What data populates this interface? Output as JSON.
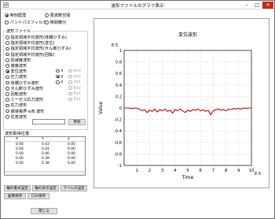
{
  "window": {
    "title": "波形ファイルのグラフ表示"
  },
  "mode_options": [
    {
      "label": "時刻歴歴",
      "selected": true
    },
    {
      "label": "周波数空間",
      "selected": false
    },
    {
      "label": "パンドパスフィルタ",
      "selected": false
    },
    {
      "label": "時間積分",
      "selected": false
    }
  ],
  "file_group": {
    "title": "波形ファイル",
    "items": [
      {
        "label": "指定領域平均波形(体積ひずみ)",
        "selected": false
      },
      {
        "label": "指定領域平均波形(変位)",
        "selected": false
      },
      {
        "label": "指定領域平均波形(せん断ひずみ)",
        "selected": false
      },
      {
        "label": "指定領域平均波形(回転)",
        "selected": false
      },
      {
        "label": "加速度波形",
        "selected": false
      },
      {
        "label": "速度波形",
        "selected": false
      },
      {
        "label": "変位波形",
        "selected": true
      },
      {
        "label": "圧力波形",
        "selected": false
      },
      {
        "label": "体積ひずみ波形",
        "selected": false
      },
      {
        "label": "せん断ひずみ波形",
        "selected": false
      },
      {
        "label": "回転波形",
        "selected": false
      },
      {
        "label": "ミーゼス応力波形",
        "selected": false
      },
      {
        "label": "応力波形",
        "selected": false
      },
      {
        "label": "誘導電界 e/B 波形",
        "selected": false
      },
      {
        "label": "任意波形",
        "selected": false
      }
    ],
    "component_options": [
      {
        "label": "x",
        "selected": false,
        "disabled": false
      },
      {
        "label": "y",
        "selected": true,
        "disabled": false
      },
      {
        "label": "z",
        "selected": false,
        "disabled": false
      }
    ],
    "stress_options": [
      {
        "label": "σxx",
        "disabled": true
      },
      {
        "label": "σyy",
        "disabled": true
      },
      {
        "label": "σzz",
        "disabled": true
      },
      {
        "label": "Exy",
        "disabled": true
      },
      {
        "label": "Eyz",
        "disabled": true
      },
      {
        "label": "Ezx",
        "disabled": true
      }
    ],
    "browse_label": "参照"
  },
  "output_positions": {
    "title": "波形取得位置",
    "headers": [
      "X",
      "Y",
      "Z"
    ],
    "rows": [
      [
        "0.00",
        "0.43",
        "0.00"
      ],
      [
        "0.00",
        "0.41",
        "0.00"
      ],
      [
        "0.00",
        "0.40",
        "0.00"
      ],
      [
        "0.00",
        "0.39",
        "0.00"
      ],
      [
        "0.00",
        "0.38",
        "0.00"
      ]
    ]
  },
  "buttons": {
    "axis_settings": "軸の書式設定",
    "axis_range": "軸の表示設定",
    "label_settings": "ラベルの設定",
    "save_image": "画像保存",
    "save_csv": "CSV保存",
    "close": "閉じる"
  },
  "chart_data": {
    "type": "line",
    "title": "変位波形",
    "xlabel": "Time",
    "ylabel": "Value",
    "x_exponent": "E-5",
    "y_exponent": "E-5",
    "xlim": [
      0,
      10
    ],
    "ylim": [
      -1,
      1
    ],
    "x_ticks": [
      "1",
      "2",
      "3",
      "4",
      "5",
      "6",
      "7",
      "8",
      "9",
      "10"
    ],
    "y_ticks": [
      "1",
      "0.8",
      "0.6",
      "0.4",
      "0.2",
      "0",
      "-0.2",
      "-0.4",
      "-0.6",
      "-0.8",
      "-1"
    ],
    "grid": true,
    "color": "#cc0000",
    "series": [
      {
        "x": [
          0,
          0.3,
          0.6,
          0.9,
          1.2,
          1.4,
          1.6,
          1.8,
          2.0,
          2.2,
          2.4,
          2.6,
          2.8,
          3.0,
          3.2,
          3.4,
          3.6,
          3.8,
          4.0,
          4.2,
          4.4,
          4.6,
          4.8,
          5.0,
          5.2,
          5.4,
          5.6,
          5.8,
          6.0,
          6.2,
          6.4,
          6.6,
          6.8,
          7.0,
          7.2,
          7.4,
          7.6,
          7.8,
          8.0,
          8.2,
          8.4,
          8.6,
          8.8,
          9.0,
          9.2,
          9.4,
          9.6,
          9.8,
          10.0
        ],
        "y": [
          0,
          0,
          -0.01,
          0,
          -0.02,
          -0.05,
          -0.03,
          -0.08,
          -0.04,
          -0.06,
          -0.02,
          -0.07,
          -0.03,
          -0.05,
          -0.02,
          -0.06,
          -0.04,
          -0.09,
          -0.03,
          -0.05,
          -0.02,
          -0.05,
          -0.08,
          -0.04,
          -0.06,
          -0.03,
          -0.04,
          -0.02,
          -0.05,
          -0.03,
          -0.06,
          -0.04,
          -0.12,
          -0.05,
          -0.03,
          -0.02,
          -0.04,
          -0.03,
          -0.05,
          -0.02,
          -0.03,
          -0.01,
          -0.02,
          -0.01,
          -0.02,
          0,
          -0.01,
          0,
          0
        ]
      }
    ]
  }
}
